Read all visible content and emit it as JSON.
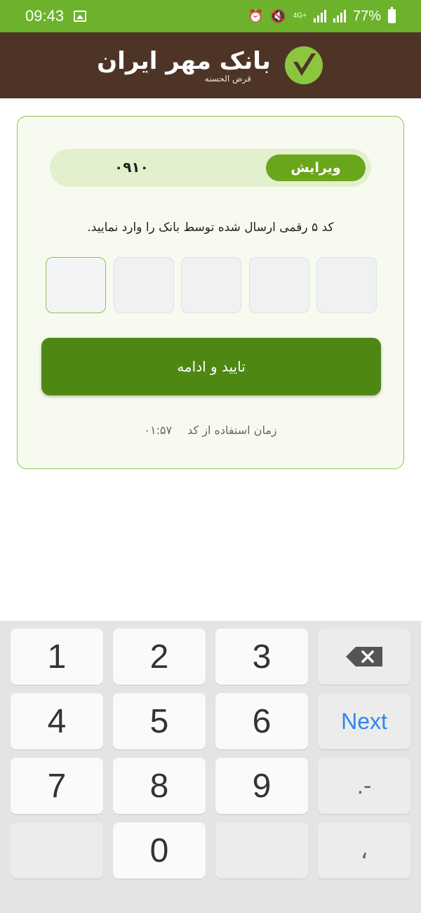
{
  "status_bar": {
    "time": "09:43",
    "network": "4G+",
    "battery": "77%"
  },
  "header": {
    "bank_name": "بانک مهر ایران",
    "bank_subtitle": "قرض الحسنه",
    "brand_color": "#6cb32b",
    "header_color": "#4e3427"
  },
  "otp": {
    "phone_number": "۰۹۱۰",
    "edit_label": "ویرایش",
    "instruction": "کد ۵ رقمی ارسال شده توسط بانک را وارد نمایید.",
    "digits": [
      "",
      "",
      "",
      "",
      ""
    ],
    "confirm_label": "تایید و ادامه",
    "timer_label": "زمان استفاده از کد",
    "timer_value": "۰۱:۵۷"
  },
  "keyboard": {
    "keys": [
      "1",
      "2",
      "3",
      "4",
      "5",
      "6",
      "7",
      "8",
      "9",
      "0"
    ],
    "next_label": "Next",
    "dot_dash": ".-",
    "comma": "،",
    "accent_color": "#2e88e8"
  }
}
